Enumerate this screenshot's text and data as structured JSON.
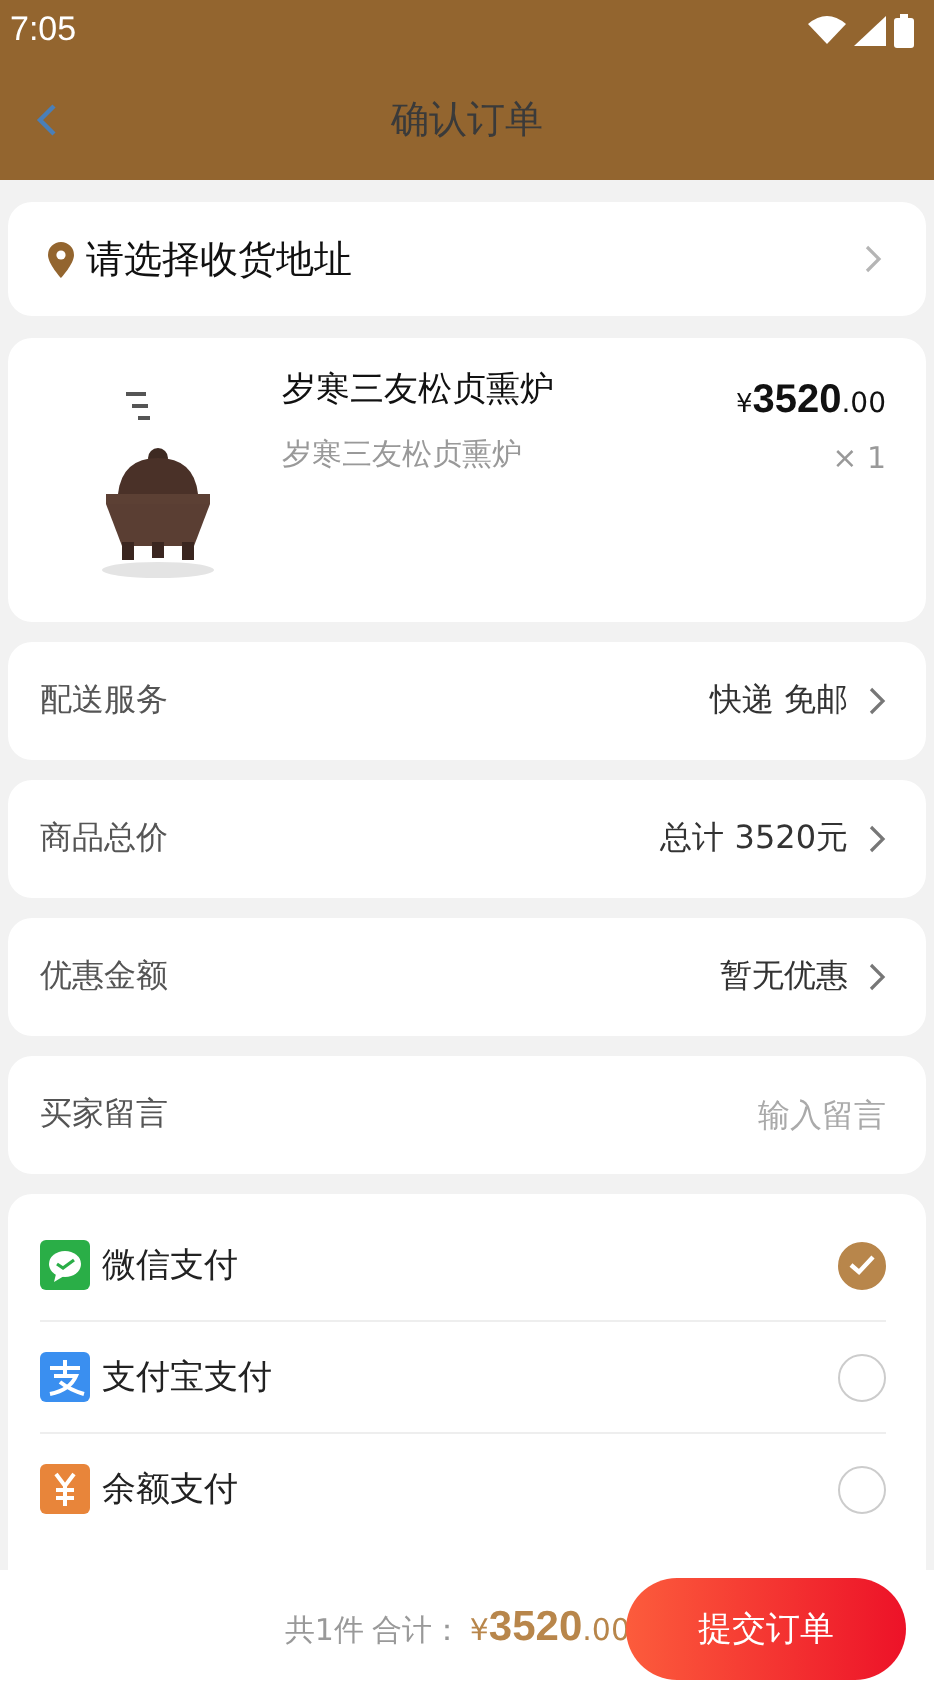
{
  "status_bar": {
    "time": "7:05"
  },
  "header": {
    "title": "确认订单"
  },
  "address": {
    "label": "请选择收货地址"
  },
  "product": {
    "name": "岁寒三友松贞熏炉",
    "spec": "岁寒三友松贞熏炉",
    "currency": "¥",
    "price_integer": "3520",
    "price_decimal": ".00",
    "quantity": "× 1"
  },
  "rows": [
    {
      "kind": "link",
      "label": "配送服务",
      "value": "快递 免邮"
    },
    {
      "kind": "link",
      "label": "商品总价",
      "value": "总计 3520元"
    },
    {
      "kind": "link",
      "label": "优惠金额",
      "value": "暂无优惠"
    },
    {
      "kind": "input",
      "label": "买家留言",
      "placeholder": "输入留言"
    }
  ],
  "payment": [
    {
      "kind": "wechat",
      "name": "微信支付",
      "selected": true
    },
    {
      "kind": "alipay",
      "name": "支付宝支付",
      "selected": false
    },
    {
      "kind": "balance",
      "name": "余额支付",
      "selected": false
    }
  ],
  "footer": {
    "count": "共1件",
    "total_label": "合计：",
    "currency": "¥",
    "amount_integer": "3520",
    "amount_decimal": ".00",
    "submit": "提交订单"
  }
}
